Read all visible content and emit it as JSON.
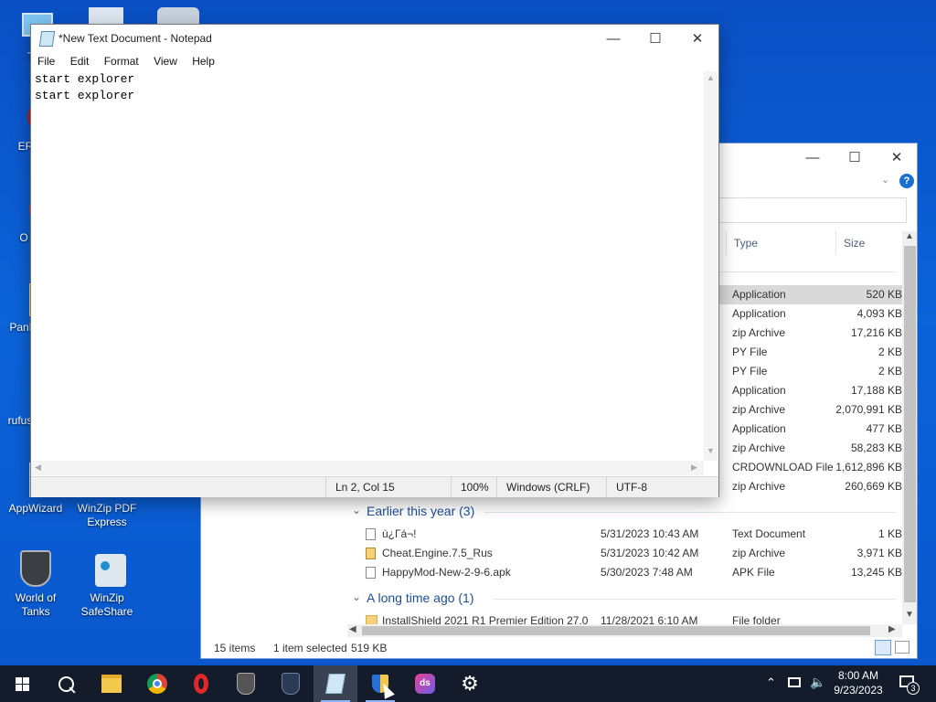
{
  "desktop": {
    "icons": [
      {
        "label": "Th"
      },
      {
        "label": "ERRO"
      },
      {
        "label": "O Bro"
      },
      {
        "label": "PanKe x"
      },
      {
        "label": "rufus"
      },
      {
        "label": "AppWizard"
      },
      {
        "label": "WinZip PDF Express"
      },
      {
        "label": "World of Tanks"
      },
      {
        "label": "WinZip SafeShare"
      }
    ]
  },
  "notepad": {
    "title": "*New Text Document - Notepad",
    "menu": [
      "File",
      "Edit",
      "Format",
      "View",
      "Help"
    ],
    "content": "start explorer\nstart explorer",
    "status": {
      "position": "Ln 2, Col 15",
      "zoom": "100%",
      "line_endings": "Windows (CRLF)",
      "encoding": "UTF-8"
    }
  },
  "explorer": {
    "columns": {
      "type": "Type",
      "size": "Size"
    },
    "rows_top": [
      {
        "type": "Application",
        "size": "520 KB",
        "selected": true
      },
      {
        "type": "Application",
        "size": "4,093 KB"
      },
      {
        "type": "zip Archive",
        "size": "17,216 KB"
      },
      {
        "type": "PY File",
        "size": "2 KB"
      },
      {
        "type": "PY File",
        "size": "2 KB"
      },
      {
        "type": "Application",
        "size": "17,188 KB"
      },
      {
        "type": "zip Archive",
        "size": "2,070,991 KB"
      },
      {
        "type": "Application",
        "size": "477 KB"
      },
      {
        "type": "zip Archive",
        "size": "58,283 KB"
      },
      {
        "type": "CRDOWNLOAD File",
        "size": "1,612,896 KB"
      },
      {
        "type": "zip Archive",
        "size": "260,669 KB"
      }
    ],
    "group_earlier": "Earlier this year (3)",
    "rows_earlier": [
      {
        "name": "ù¿Гá¬!",
        "date": "5/31/2023 10:43 AM",
        "type": "Text Document",
        "size": "1 KB"
      },
      {
        "name": "Cheat.Engine.7.5_Rus",
        "date": "5/31/2023 10:42 AM",
        "type": "zip Archive",
        "size": "3,971 KB"
      },
      {
        "name": "HappyMod-New-2-9-6.apk",
        "date": "5/30/2023 7:48 AM",
        "type": "APK File",
        "size": "13,245 KB"
      }
    ],
    "group_long": "A long time ago (1)",
    "row_long": {
      "name": "InstallShield 2021 R1 Premier Edition 27.0",
      "date": "11/28/2021 6:10 AM",
      "type": "File folder"
    },
    "status": {
      "items": "15 items",
      "selected": "1 item selected",
      "size": "519 KB"
    }
  },
  "taskbar": {
    "time": "8:00 AM",
    "date": "9/23/2023",
    "notifications": "3"
  },
  "colors": {
    "desktop": "#0b5fd6",
    "taskbar": "#141c2b",
    "group_header": "#1e4e9e"
  }
}
